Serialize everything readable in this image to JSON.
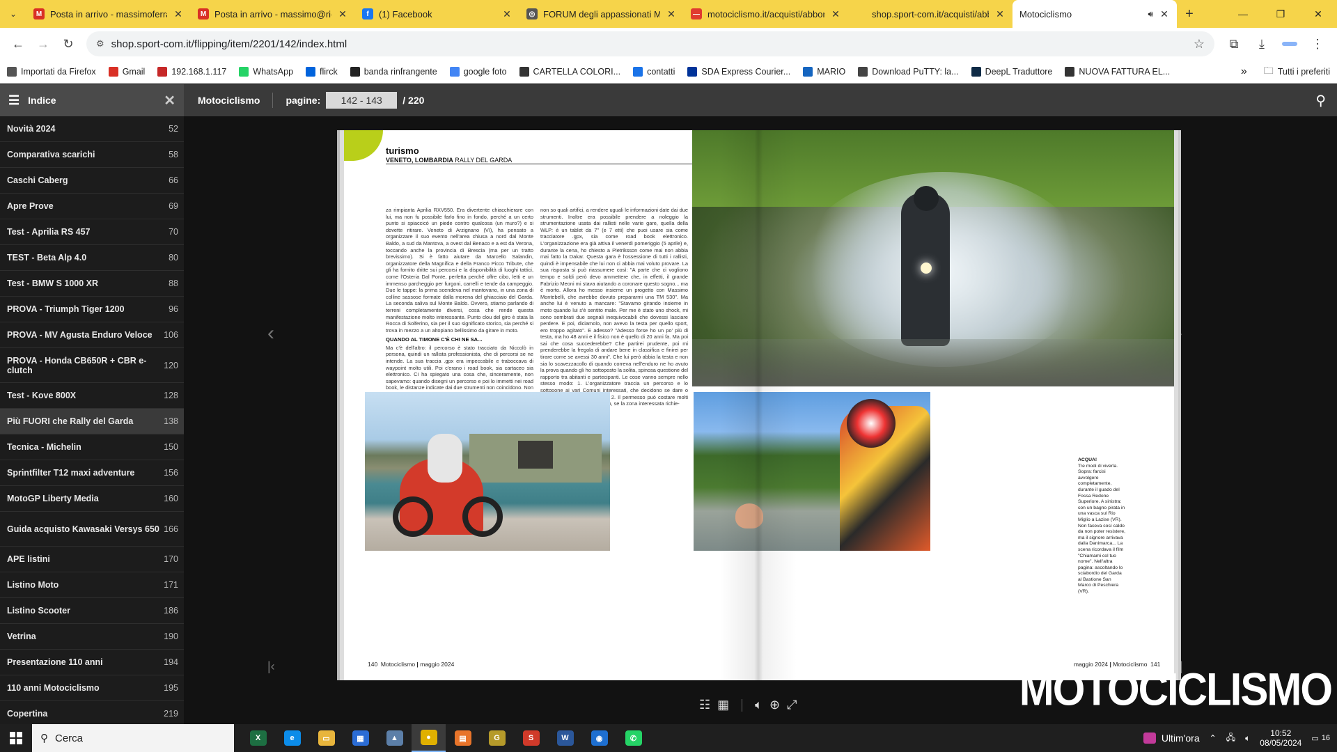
{
  "browser": {
    "tabs": [
      {
        "title": "Posta in arrivo - massimoferrara",
        "favicon": "gmail-icon",
        "color": "#d93025",
        "letter": "M"
      },
      {
        "title": "Posta in arrivo - massimo@rica",
        "favicon": "gmail-icon",
        "color": "#d93025",
        "letter": "M"
      },
      {
        "title": "(1) Facebook",
        "favicon": "facebook-icon",
        "color": "#1877f2",
        "letter": "f"
      },
      {
        "title": "FORUM degli appassionati MO",
        "favicon": "globe-icon",
        "color": "#555",
        "letter": "◎"
      },
      {
        "title": "motociclismo.it/acquisti/abbon",
        "favicon": "motociclismo-icon",
        "color": "#e03b2f",
        "letter": "—"
      },
      {
        "title": "shop.sport-com.it/acquisti/abb",
        "favicon": "blank-icon",
        "color": "#f6d44a",
        "letter": ""
      },
      {
        "title": "Motociclismo",
        "favicon": "audio-icon",
        "color": "#fff",
        "letter": ""
      }
    ],
    "url": "shop.sport-com.it/flipping/item/2201/142/index.html",
    "bookmarks": [
      {
        "label": "Importati da Firefox",
        "color": "#555"
      },
      {
        "label": "Gmail",
        "color": "#d93025"
      },
      {
        "label": "192.168.1.117",
        "color": "#c62828"
      },
      {
        "label": "WhatsApp",
        "color": "#25d366"
      },
      {
        "label": "flirck",
        "color": "#0063dc"
      },
      {
        "label": "banda rinfrangente",
        "color": "#222"
      },
      {
        "label": "google foto",
        "color": "#4285f4"
      },
      {
        "label": "CARTELLA COLORI...",
        "color": "#333"
      },
      {
        "label": "contatti",
        "color": "#1a73e8"
      },
      {
        "label": "SDA Express Courier...",
        "color": "#003399"
      },
      {
        "label": "MARIO",
        "color": "#1565c0"
      },
      {
        "label": "Download PuTTY: la...",
        "color": "#444"
      },
      {
        "label": "DeepL Traduttore",
        "color": "#0f2b46"
      },
      {
        "label": "NUOVA FATTURA EL...",
        "color": "#333"
      }
    ],
    "bookmarks_more": "»",
    "all_bookmarks": "Tutti i preferiti"
  },
  "viewer": {
    "index_title": "Indice",
    "magazine": "Motociclismo",
    "pages_label": "pagine:",
    "pages_value": "142 - 143",
    "pages_total": "/ 220"
  },
  "index": [
    {
      "label": "Novità 2024",
      "page": "52"
    },
    {
      "label": "Comparativa scarichi",
      "page": "58"
    },
    {
      "label": "Caschi Caberg",
      "page": "66"
    },
    {
      "label": "Apre Prove",
      "page": "69"
    },
    {
      "label": "Test - Aprilia RS 457",
      "page": "70"
    },
    {
      "label": "TEST - Beta Alp 4.0",
      "page": "80"
    },
    {
      "label": "Test - BMW S 1000 XR",
      "page": "88"
    },
    {
      "label": "PROVA - Triumph Tiger 1200",
      "page": "96"
    },
    {
      "label": "PROVA - MV Agusta Enduro Veloce",
      "page": "106"
    },
    {
      "label": "PROVA - Honda CB650R + CBR e-clutch",
      "page": "120"
    },
    {
      "label": "Test - Kove 800X",
      "page": "128"
    },
    {
      "label": "Più FUORI che Rally del Garda",
      "page": "138"
    },
    {
      "label": "Tecnica - Michelin",
      "page": "150"
    },
    {
      "label": "Sprintfilter T12 maxi adventure",
      "page": "156"
    },
    {
      "label": "MotoGP Liberty Media",
      "page": "160"
    },
    {
      "label": "Guida acquisto Kawasaki Versys 650",
      "page": "166"
    },
    {
      "label": "APE listini",
      "page": "170"
    },
    {
      "label": "Listino Moto",
      "page": "171"
    },
    {
      "label": "Listino Scooter",
      "page": "186"
    },
    {
      "label": "Vetrina",
      "page": "190"
    },
    {
      "label": "Presentazione 110 anni",
      "page": "194"
    },
    {
      "label": "110 anni Motociclismo",
      "page": "195"
    },
    {
      "label": "Copertina",
      "page": "219"
    }
  ],
  "article": {
    "section": "turismo",
    "region": "VENETO, LOMBARDIA",
    "subtitle": "RALLY DEL GARDA",
    "col1_a": "za rimpianta Aprilia RXV550. Era divertente chiacchierare con lui, ma non fu possibile farlo fino in fondo, perché a un certo punto si spiaccicò un piede contro qualcosa (un muro?) e si dovette ritirare. Veneto di Arzignano (VI), ha pensato a organizzare il suo evento nell'area chiusa a nord dal Monte Baldo, a sud da Mantova, a ovest dal Benaco e a est da Verona, toccando anche la provincia di Brescia (ma per un tratto brevissimo). Si è fatto aiutare da Marcello Salandin, organizzatore della Magnifica e della Franco Picco Tribute, che gli ha fornito dritte sui percorsi e la disponibilità di luoghi tattici, come l'Osteria Dal Ponte, perfetta perché offre cibo, letti e un immenso parcheggio per furgoni, carrelli e tende da campeggio. Due le tappe: la prima scendeva nel mantovano, in una zona di colline sassose formate dalla morena del ghiacciaio del Garda. La seconda saliva sul Monte Baldo. Ovvero, stiamo parlando di terreni completamente diversi, cosa che rende questa manifestazione molto interessante. Punto clou del giro è stata la Rocca di Solferino, sia per il suo significato storico, sia perché si trova in mezzo a un altopiano bellissimo da girare in moto.",
    "col1_head": "QUANDO AL TIMONE C'È CHI NE SA...",
    "col1_b": "Ma c'è dell'altro: il percorso è stato tracciato da Niccolò in persona, quindi un rallista professionista, che di percorsi se ne intende. La sua traccia .gpx era impeccabile e traboccava di waypoint molto utili. Poi c'erano i road book, sia cartaceo sia elettronico. Ci ha spiegato una cosa che, sinceramente, non sapevamo: quando disegni un percorso e poi lo immetti nei road book, le distanze indicate dai due strumenti non coincidono. Non chiedetemi perché, dato che non c'ho capito nulla, ma lui era orgoglioso per essere riuscito, con",
    "col2": "non so quali artifici, a rendere uguali le informazioni date dai due strumenti. Inoltre era possibile prendere a noleggio la strumentazione usata dai rallisti nelle varie gare, quella della WLP: è un tablet da 7\" (e 7 etti) che puoi usare sia come tracciatore .gpx, sia come road book elettronico. L'organizzazione era già attiva il venerdì pomeriggio (5 aprile) e, durante la cena, ho chiesto a Pietriksson come mai non abbia mai fatto la Dakar. Questa gara è l'ossessione di tutti i rallisti, quindi è impensabile che lui non ci abbia mai voluto provare. La sua risposta si può riassumere così: \"A parte che ci vogliono tempo e soldi però devo ammettere che, in effetti, il grande Fabrizio Meoni mi stava aiutando a coronare questo sogno... ma è morto. Allora ho messo insieme un progetto con Massimo Montebelli, che avrebbe dovuto prepararmi una TM 530\". Ma anche lui è venuto a mancare: \"Stavamo girando insieme in moto quando lui s'è sentito male. Per me è stato uno shock, mi sono sembrati due segnali inequivocabili che dovessi lasciare perdere. E poi, diciamolo, non avevo la testa per quello sport, ero troppo agitato\". E adesso? \"Adesso forse ho un po' più di testa, ma ho 48 anni e il fisico non è quello di 20 anni fa. Ma poi sai che cosa succederebbe? Che partirei prudente, poi mi prenderebbe la fregola di andare bene in classifica e finirei per tirare come se avessi 30 anni\". Che lui però abbia la testa e non sia lo scavezzacollo di quando correva nell'enduro ne ho avuto la prova quando gli ho sottoposto la solita, spinosa questione del rapporto tra abitanti e partecipanti. Le cose vanno sempre nello stesso modo: 1. L'organizzatore traccia un percorso e lo sottopone ai vari Comuni interessati, che decidono se dare o meno il permesso di transito. 2. Il permesso può costare molti soldi, anche un migliaio di euro, se la zona interessata richie-",
    "caption_title": "ACQUA!",
    "caption": "Tre modi di viverla. Sopra: farcisi avvolgere completamente, durante il guado del Fossa Redone Superiore. A sinistra: con un bagno pirata in una vasca sul Rio Miglio a Lazise (VR). Non faceva così caldo da non poter resistere, ma il signore arrivava dalla Danimarca... La scena ricordava il film \"Chiamami col tuo nome\". Nell'altra pagina: ascoltando lo sciabordio del Garda al Bastione San Marco di Peschiera (VR).",
    "folio_left_num": "140",
    "folio_left_mag": "Motociclismo",
    "folio_left_date": "maggio 2024",
    "folio_right_date": "maggio 2024",
    "folio_right_mag": "Motociclismo",
    "folio_right_num": "141"
  },
  "brand_overlay": "MOTOCICLISMO",
  "taskbar": {
    "search_placeholder": "Cerca",
    "news": "Ultim'ora",
    "time": "10:52",
    "date": "08/05/2024",
    "notifications": "16",
    "apps": [
      {
        "name": "excel-icon",
        "color": "#1d6f42",
        "letter": "X"
      },
      {
        "name": "edge-icon",
        "color": "#0c8ce9",
        "letter": "e"
      },
      {
        "name": "file-explorer-icon",
        "color": "#e8b53c",
        "letter": "▭"
      },
      {
        "name": "store-icon",
        "color": "#2b6cd4",
        "letter": "▦"
      },
      {
        "name": "app-icon",
        "color": "#5c7fa8",
        "letter": "▲"
      },
      {
        "name": "chrome-icon",
        "color": "#e0b000",
        "letter": "●"
      },
      {
        "name": "app-orange-icon",
        "color": "#e8742a",
        "letter": "▤"
      },
      {
        "name": "app-g-icon",
        "color": "#b59a2a",
        "letter": "G"
      },
      {
        "name": "app-s-icon",
        "color": "#d03a2a",
        "letter": "S"
      },
      {
        "name": "word-icon",
        "color": "#2b579a",
        "letter": "W"
      },
      {
        "name": "app-blue-icon",
        "color": "#1e6fd0",
        "letter": "◉"
      },
      {
        "name": "whatsapp-icon",
        "color": "#25d366",
        "letter": "✆"
      }
    ]
  }
}
